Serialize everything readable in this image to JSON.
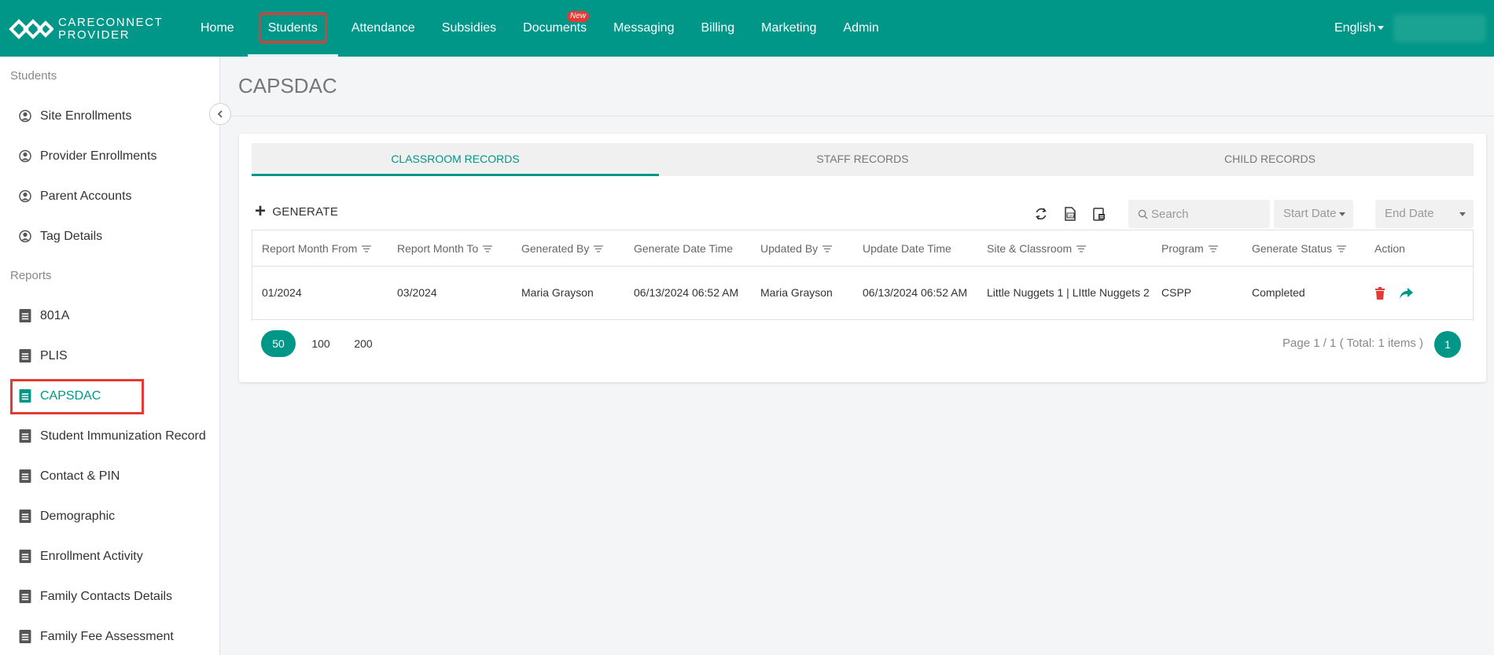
{
  "brand": {
    "line1": "CARECONNECT",
    "line2": "PROVIDER"
  },
  "nav": {
    "items": [
      {
        "label": "Home"
      },
      {
        "label": "Students"
      },
      {
        "label": "Attendance"
      },
      {
        "label": "Subsidies"
      },
      {
        "label": "Documents",
        "badge": "New"
      },
      {
        "label": "Messaging"
      },
      {
        "label": "Billing"
      },
      {
        "label": "Marketing"
      },
      {
        "label": "Admin"
      }
    ],
    "active": "Students",
    "language": "English"
  },
  "sidebar": {
    "students_heading": "Students",
    "students_items": [
      {
        "label": "Site Enrollments",
        "icon": "user-circle-icon"
      },
      {
        "label": "Provider Enrollments",
        "icon": "user-circle-icon"
      },
      {
        "label": "Parent Accounts",
        "icon": "user-circle-icon"
      },
      {
        "label": "Tag Details",
        "icon": "user-circle-icon"
      }
    ],
    "reports_heading": "Reports",
    "reports_items": [
      {
        "label": "801A",
        "icon": "document-icon"
      },
      {
        "label": "PLIS",
        "icon": "document-icon"
      },
      {
        "label": "CAPSDAC",
        "icon": "document-icon",
        "active": true
      },
      {
        "label": "Student Immunization Record",
        "icon": "document-icon"
      },
      {
        "label": "Contact & PIN",
        "icon": "document-icon"
      },
      {
        "label": "Demographic",
        "icon": "document-icon"
      },
      {
        "label": "Enrollment Activity",
        "icon": "document-icon"
      },
      {
        "label": "Family Contacts Details",
        "icon": "document-icon"
      },
      {
        "label": "Family Fee Assessment",
        "icon": "document-icon"
      }
    ]
  },
  "page": {
    "title": "CAPSDAC"
  },
  "tabs": [
    {
      "label": "CLASSROOM RECORDS",
      "active": true
    },
    {
      "label": "STAFF RECORDS"
    },
    {
      "label": "CHILD RECORDS"
    }
  ],
  "toolbar": {
    "generate_label": "GENERATE",
    "search_placeholder": "Search",
    "start_date_placeholder": "Start Date",
    "end_date_placeholder": "End Date"
  },
  "table": {
    "columns": [
      "Report Month From",
      "Report Month To",
      "Generated By",
      "Generate Date Time",
      "Updated By",
      "Update Date Time",
      "Site & Classroom",
      "Program",
      "Generate Status",
      "Action"
    ],
    "rows": [
      {
        "report_month_from": "01/2024",
        "report_month_to": "03/2024",
        "generated_by": "Maria Grayson",
        "generate_date_time": "06/13/2024 06:52 AM",
        "updated_by": "Maria Grayson",
        "update_date_time": "06/13/2024 06:52 AM",
        "site_classroom": "Little Nuggets 1 | LIttle Nuggets 2",
        "program": "CSPP",
        "generate_status": "Completed"
      }
    ]
  },
  "pagination": {
    "page_sizes": [
      "50",
      "100",
      "200"
    ],
    "active_size": "50",
    "info": "Page 1 / 1 ( Total: 1 items )",
    "current_page": "1"
  },
  "colors": {
    "primary": "#009688",
    "highlight": "#e53935",
    "delete": "#e53935"
  }
}
